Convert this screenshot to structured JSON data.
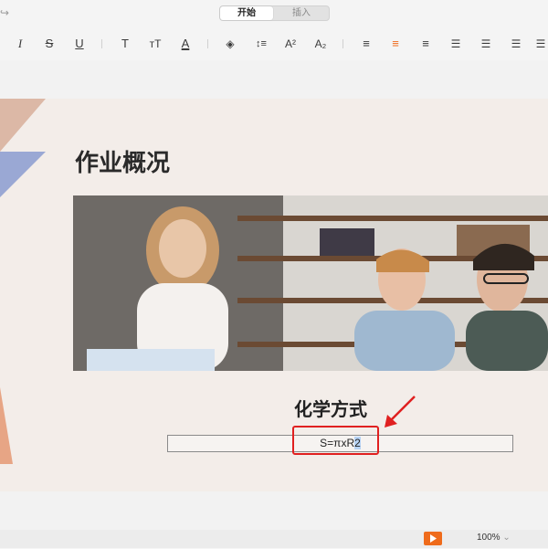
{
  "tabs": [
    {
      "label": "开始",
      "active": true
    },
    {
      "label": "插入",
      "active": false
    }
  ],
  "toolbar": [
    {
      "name": "italic-button",
      "glyph": "I"
    },
    {
      "name": "strikethrough-button",
      "glyph": "S"
    },
    {
      "name": "underline-button",
      "glyph": "U"
    },
    {
      "name": "text-size-button",
      "glyph": "T"
    },
    {
      "name": "text-size-small-button",
      "glyph": "ᴛT"
    },
    {
      "name": "font-color-button",
      "glyph": "A"
    },
    {
      "name": "fill-bucket-button",
      "glyph": "◈"
    },
    {
      "name": "line-spacing-button",
      "glyph": "↕≡"
    },
    {
      "name": "superscript-button",
      "glyph": "A²"
    },
    {
      "name": "subscript-button",
      "glyph": "A₂"
    },
    {
      "name": "align-left-button",
      "glyph": "≡"
    },
    {
      "name": "align-center-button",
      "glyph": "≡"
    },
    {
      "name": "align-right-button",
      "glyph": "≡"
    },
    {
      "name": "bullet-list-button",
      "glyph": "☰"
    },
    {
      "name": "numbered-list-button",
      "glyph": "☰"
    },
    {
      "name": "indent-list-button",
      "glyph": "☰"
    },
    {
      "name": "more-list-button",
      "glyph": "☰"
    }
  ],
  "colors": {
    "accent": "#ef6b1b",
    "annotation": "#e02020",
    "selection": "#b7d3f5"
  },
  "slide": {
    "title": "作业概况",
    "subtitle": "化学方式",
    "formula_main": "S=πxR",
    "formula_selected": "2"
  },
  "status": {
    "zoom": "100%"
  }
}
